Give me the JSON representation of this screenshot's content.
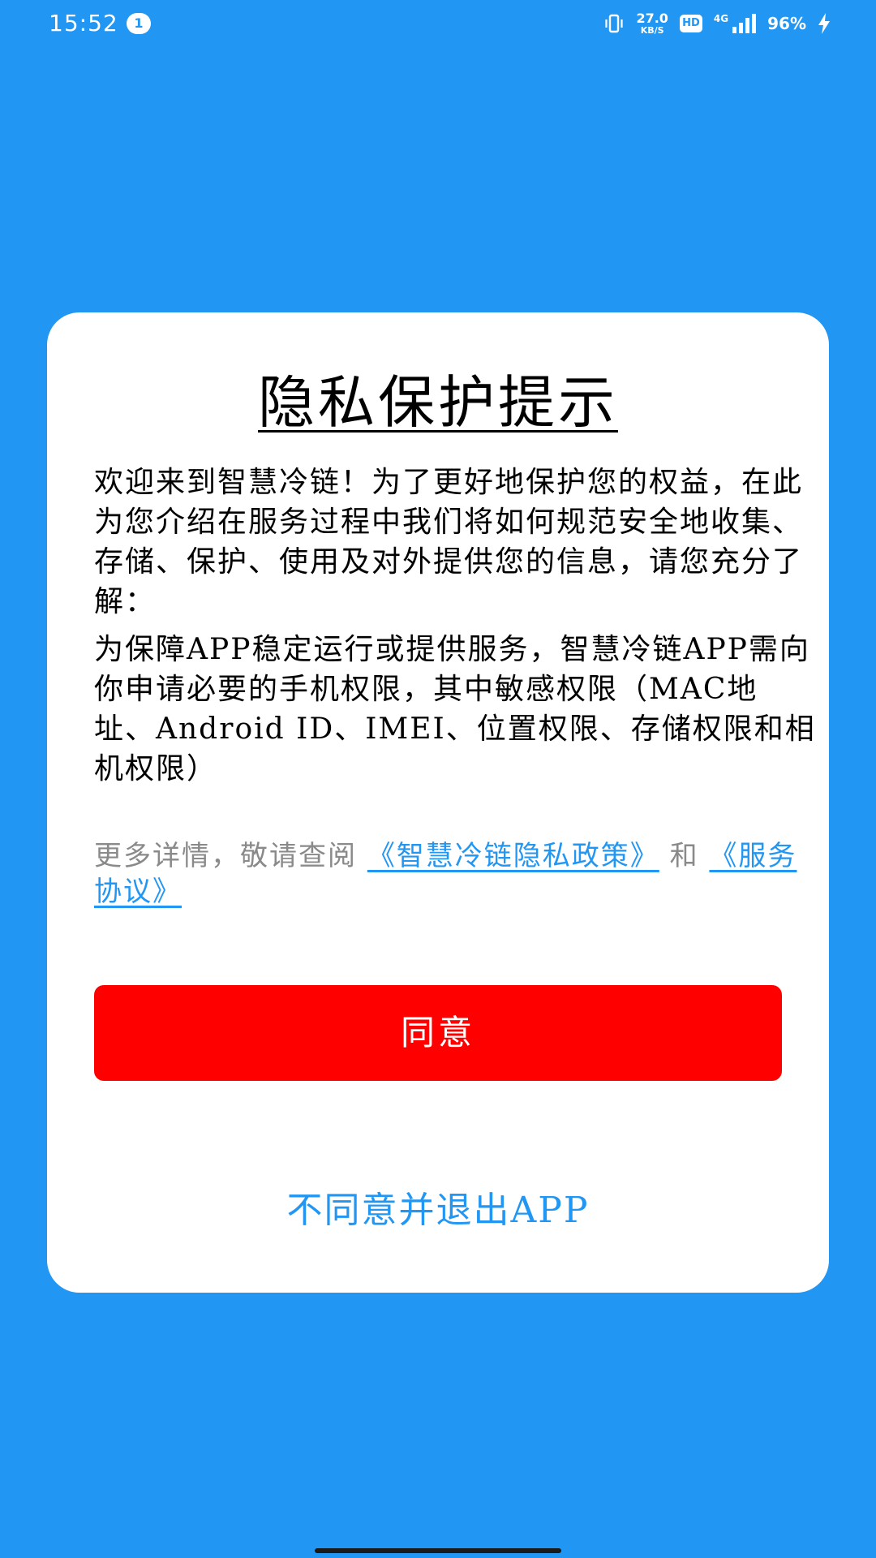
{
  "status_bar": {
    "time": "15:52",
    "notification_count": "1",
    "net_speed_value": "27.0",
    "net_speed_unit": "KB/S",
    "hd_label": "HD",
    "network_label": "4G",
    "battery": "96%",
    "icons": [
      "vibrate-icon",
      "signal-icon",
      "charging-bolt-icon"
    ]
  },
  "dialog": {
    "title": "隐私保护提示",
    "paragraph_1": "欢迎来到智慧冷链！为了更好地保护您的权益，在此为您介绍在服务过程中我们将如何规范安全地收集、存储、保护、使用及对外提供您的信息，请您充分了解：",
    "paragraph_2": "为保障APP稳定运行或提供服务，智慧冷链APP需向你申请必要的手机权限，其中敏感权限（MAC地址、Android ID、IMEI、位置权限、存储权限和相机权限）",
    "more_prefix": "更多详情，敬请查阅",
    "privacy_link": "《智慧冷链隐私政策》",
    "more_and": "和",
    "service_link": "《服务协议》",
    "agree_label": "同意",
    "disagree_label": "不同意并退出APP"
  },
  "colors": {
    "background": "#2196F3",
    "agree_button": "#ff0000",
    "link": "#2196F3"
  }
}
